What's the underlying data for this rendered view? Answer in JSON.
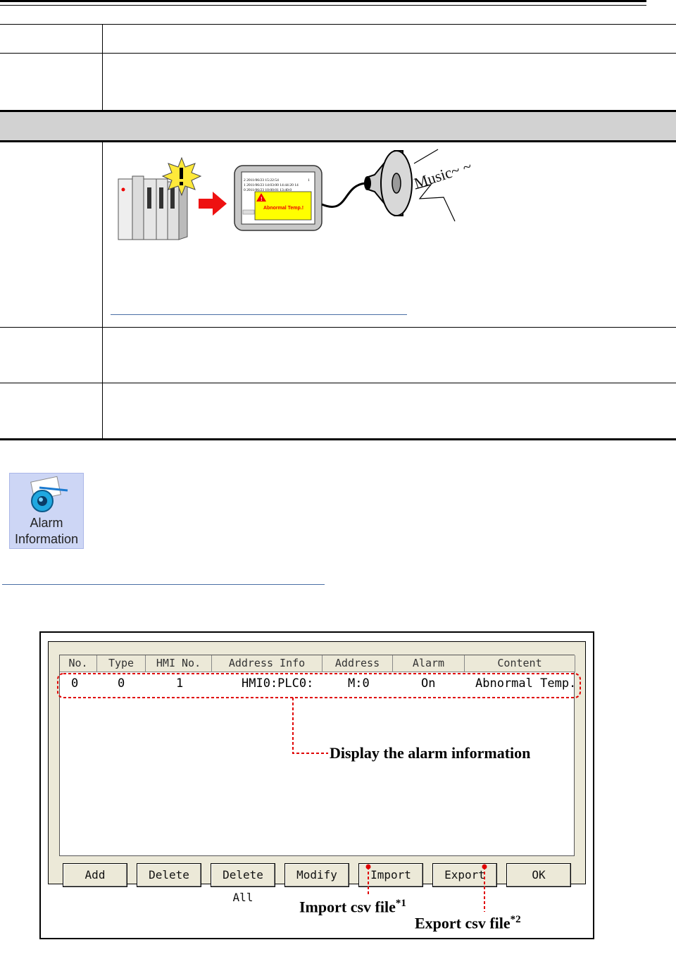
{
  "illustration": {
    "hmi_rows": [
      "2 2011/06/23 15:22:54",
      "1 2011/06/23 14:03:00 14:44:20 14",
      "0 2011/06/23 10:00:01 13:40:0"
    ],
    "hmi_row_right": "1",
    "popup_text": "Abnormal Temp.!",
    "speaker_text": "Music~ ~"
  },
  "tool_icon": {
    "line1": "Alarm",
    "line2": "Information"
  },
  "dialog": {
    "columns": [
      "No.",
      "Type",
      "HMI No.",
      "Address Info",
      "Address",
      "Alarm",
      "Content"
    ],
    "rows": [
      [
        "0",
        "0",
        "1",
        "HMI0:PLC0:",
        "M:0",
        "On",
        "Abnormal Temp."
      ]
    ],
    "buttons": [
      "Add",
      "Delete",
      "Delete All",
      "Modify",
      "Import",
      "Export",
      "OK"
    ]
  },
  "annotations": {
    "display": "Display the alarm information",
    "import": "Import csv file",
    "import_sup": "*1",
    "export": "Export csv file",
    "export_sup": "*2"
  },
  "colors": {
    "annotation_red": "#e00000",
    "popup_yellow": "#ffff00",
    "arrow_red": "#ee1111",
    "section_gray": "#d2d2d2"
  }
}
